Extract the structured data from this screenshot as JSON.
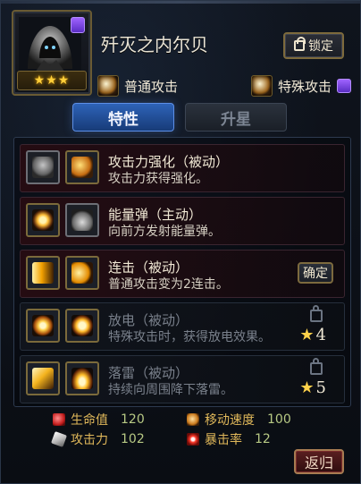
{
  "header": {
    "character_name": "歼灭之内尔贝",
    "lock_button_label": "锁定",
    "stars": "★★★"
  },
  "attack_modes": [
    {
      "label": "普通攻击",
      "icon": "claw-slash-icon"
    },
    {
      "label": "特殊攻击",
      "icon": "lightning-slash-icon"
    }
  ],
  "tabs": [
    {
      "label": "特性",
      "active": true
    },
    {
      "label": "升星",
      "active": false
    }
  ],
  "skills": [
    {
      "name": "攻击力强化（被动）",
      "description": "攻击力获得强化。",
      "locked": false
    },
    {
      "name": "能量弹（主动）",
      "description": "向前方发射能量弹。",
      "locked": false
    },
    {
      "name": "连击（被动）",
      "description": "普通攻击变为2连击。",
      "locked": false,
      "action_label": "确定"
    },
    {
      "name": "放电（被动）",
      "description": "特殊攻击时，获得放电效果。",
      "locked": true,
      "required_star": "4"
    },
    {
      "name": "落雷（被动）",
      "description": "持续向周围降下落雷。",
      "locked": true,
      "required_star": "5"
    }
  ],
  "stats": {
    "hp": {
      "label": "生命值",
      "value": "120"
    },
    "atk": {
      "label": "攻击力",
      "value": "102"
    },
    "move_speed": {
      "label": "移动速度",
      "value": "100"
    },
    "crit_rate": {
      "label": "暴击率",
      "value": "12"
    }
  },
  "footer": {
    "return_label": "返归"
  },
  "colors": {
    "accent_blue": "#2e63b8",
    "gold": "#ffcf3a",
    "panel_red": "#3a2530"
  }
}
